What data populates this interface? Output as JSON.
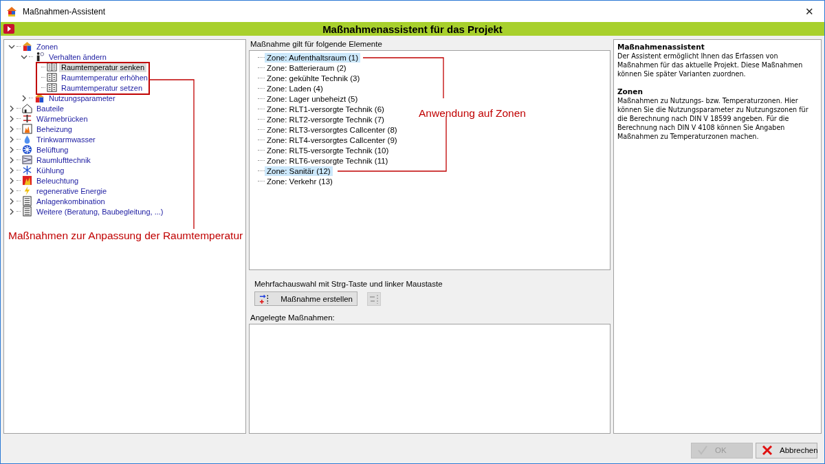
{
  "window": {
    "title": "Maßnahmen-Assistent",
    "close": "✕"
  },
  "header": {
    "title": "Maßnahmenassistent für das Projekt"
  },
  "tree": [
    {
      "label": "Zonen",
      "expanded": true,
      "selected": false,
      "children": [
        {
          "label": "Verhalten ändern",
          "expanded": true,
          "selected": false,
          "children": [
            {
              "label": "Raumtemperatur senken",
              "selected": true
            },
            {
              "label": "Raumtemperatur erhöhen",
              "selected": false
            },
            {
              "label": "Raumtemperatur setzen",
              "selected": false
            }
          ]
        },
        {
          "label": "Nutzungsparameter",
          "expanded": false,
          "selected": false
        }
      ]
    },
    {
      "label": "Bauteile",
      "expanded": false,
      "selected": false
    },
    {
      "label": "Wärmebrücken",
      "expanded": false,
      "selected": false
    },
    {
      "label": "Beheizung",
      "expanded": false,
      "selected": false
    },
    {
      "label": "Trinkwarmwasser",
      "expanded": false,
      "selected": false
    },
    {
      "label": "Belüftung",
      "expanded": false,
      "selected": false
    },
    {
      "label": "Raumlufttechnik",
      "expanded": false,
      "selected": false
    },
    {
      "label": "Kühlung",
      "expanded": false,
      "selected": false
    },
    {
      "label": "Beleuchtung",
      "expanded": false,
      "selected": false
    },
    {
      "label": "regenerative Energie",
      "expanded": false,
      "selected": false
    },
    {
      "label": "Anlagenkombination",
      "expanded": false,
      "selected": false
    },
    {
      "label": "Weitere (Beratung, Baubegleitung, ...)",
      "expanded": false,
      "selected": false
    }
  ],
  "left_annotation": "Maßnahmen zur Anpassung der Raumtemperatur",
  "elements": {
    "label": "Maßnahme gilt für folgende Elemente",
    "items": [
      {
        "label": "Zone: Aufenthaltsraum (1)",
        "selected": true
      },
      {
        "label": "Zone: Batterieraum (2)",
        "selected": false
      },
      {
        "label": "Zone: gekühlte Technik (3)",
        "selected": false
      },
      {
        "label": "Zone: Laden (4)",
        "selected": false
      },
      {
        "label": "Zone: Lager unbeheizt (5)",
        "selected": false
      },
      {
        "label": "Zone: RLT1-versorgte Technik (6)",
        "selected": false
      },
      {
        "label": "Zone: RLT2-versorgte Technik (7)",
        "selected": false
      },
      {
        "label": "Zone: RLT3-versorgtes Callcenter (8)",
        "selected": false
      },
      {
        "label": "Zone: RLT4-versorgtes Callcenter (9)",
        "selected": false
      },
      {
        "label": "Zone: RLT5-versorgte Technik (10)",
        "selected": false
      },
      {
        "label": "Zone: RLT6-versorgte Technik (11)",
        "selected": false
      },
      {
        "label": "Zone: Sanitär (12)",
        "selected": true
      },
      {
        "label": "Zone: Verkehr (13)",
        "selected": false
      }
    ],
    "annotation": "Anwendung auf Zonen"
  },
  "hint": "Mehrfachauswahl mit Strg-Taste und linker Maustaste",
  "create_button": {
    "label": "Maßnahme erstellen"
  },
  "created": {
    "label": "Angelegte Maßnahmen:"
  },
  "info": [
    {
      "heading": "Maßnahmenassistent",
      "text": "Der Assistent ermöglicht Ihnen das Erfassen von Maßnahmen für das aktuelle Projekt. Diese Maßnahmen können Sie später Varianten zuordnen."
    },
    {
      "heading": "Zonen",
      "text": "Maßnahmen zu Nutzungs- bzw. Temperaturzonen. Hier können Sie die Nutzungsparameter zu Nutzungszonen für die Berechnung nach DIN V 18599 angeben. Für die Berechnung nach DIN V 4108 können Sie Angaben Maßnahmen zu Temperaturzonen machen."
    }
  ],
  "buttons": [
    {
      "label": "OK",
      "disabled": true
    },
    {
      "label": "Abbrechen",
      "disabled": false
    }
  ]
}
